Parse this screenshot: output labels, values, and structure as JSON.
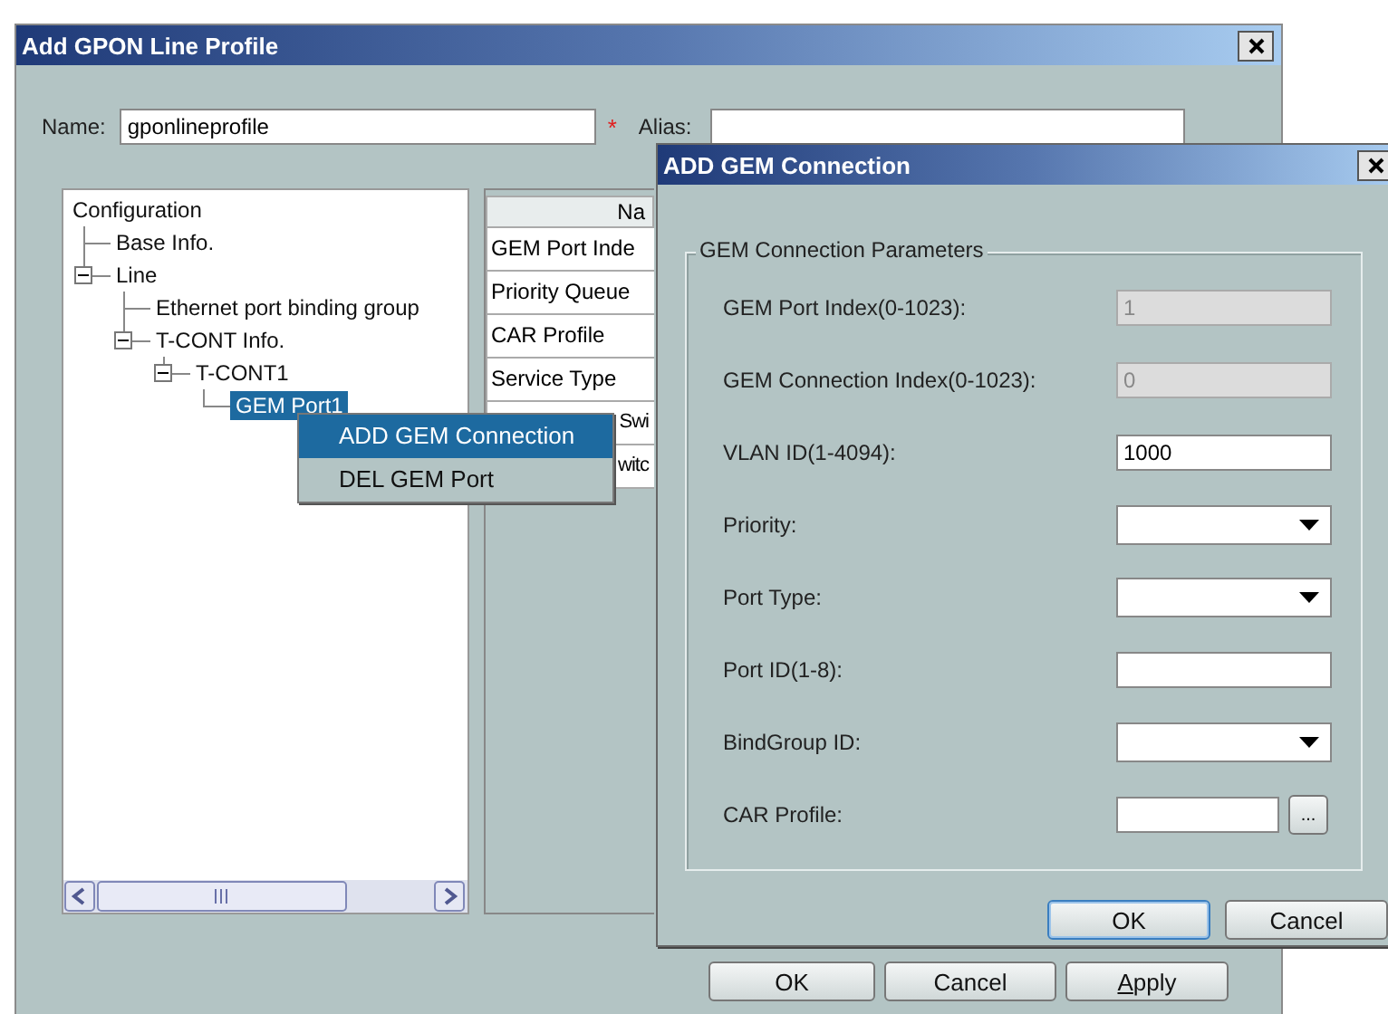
{
  "main_window": {
    "title": "Add GPON Line Profile",
    "name_label": "Name:",
    "name_value": "gponlineprofile",
    "required_mark": "*",
    "alias_label": "Alias:",
    "tree": [
      {
        "label": "Configuration",
        "selected": false,
        "children": [
          {
            "label": "Base Info.",
            "selected": false
          },
          {
            "label": "Line",
            "expanded": true,
            "selected": false,
            "children": [
              {
                "label": "Ethernet port binding group",
                "selected": false
              },
              {
                "label": "T-CONT Info.",
                "expanded": true,
                "selected": false,
                "children": [
                  {
                    "label": "T-CONT1",
                    "expanded": true,
                    "selected": false,
                    "children": [
                      {
                        "label": "GEM Port1",
                        "selected": true
                      }
                    ]
                  }
                ]
              }
            ]
          }
        ]
      }
    ],
    "table": {
      "header": "Na",
      "rows": [
        {
          "text": "GEM Port Inde",
          "partly_hidden": false
        },
        {
          "text": "Priority Queue",
          "partly_hidden": false
        },
        {
          "text": "CAR Profile",
          "partly_hidden": false
        },
        {
          "text": "Service Type",
          "partly_hidden": false
        },
        {
          "text": "Swi",
          "partly_hidden": true
        },
        {
          "text": "witc",
          "partly_hidden": true
        }
      ]
    },
    "buttons": [
      {
        "label": "OK",
        "mnemonic": false
      },
      {
        "label": "Cancel",
        "mnemonic": false
      },
      {
        "label": "Apply",
        "mnemonic": true
      }
    ]
  },
  "context_menu": [
    {
      "label": "ADD GEM Connection",
      "selected": true
    },
    {
      "label": "DEL GEM Port",
      "selected": false
    }
  ],
  "gem_dialog": {
    "title": "ADD GEM Connection",
    "group_title": "GEM Connection Parameters",
    "fields": [
      {
        "label": "GEM Port Index(0-1023):",
        "kind": "text",
        "value": "1",
        "disabled": true
      },
      {
        "label": "GEM Connection Index(0-1023):",
        "kind": "text",
        "value": "0",
        "disabled": true
      },
      {
        "label": "VLAN ID(1-4094):",
        "kind": "text",
        "value": "1000",
        "disabled": false
      },
      {
        "label": "Priority:",
        "kind": "select"
      },
      {
        "label": "Port Type:",
        "kind": "select"
      },
      {
        "label": "Port ID(1-8):",
        "kind": "text",
        "disabled": false
      },
      {
        "label": "BindGroup ID:",
        "kind": "select"
      },
      {
        "label": "CAR Profile:",
        "kind": "browse",
        "browse_label": "..."
      }
    ],
    "buttons": [
      {
        "label": "OK",
        "focused": true
      },
      {
        "label": "Cancel",
        "focused": false
      }
    ]
  }
}
